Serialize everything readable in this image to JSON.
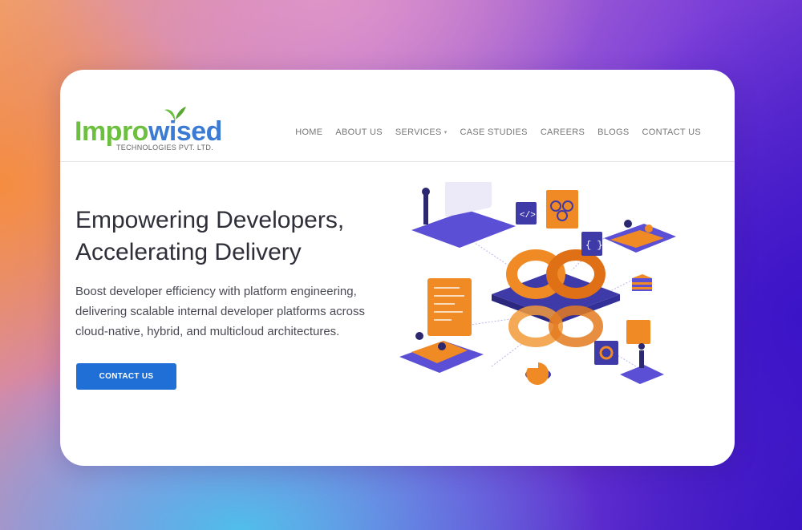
{
  "brand": {
    "name_part1": "Impro",
    "name_part2": "wised",
    "tagline": "TECHNOLOGIES PVT. LTD.",
    "colors": {
      "green": "#6cbf3f",
      "blue": "#3b7bd4"
    }
  },
  "nav": {
    "items": [
      {
        "label": "HOME"
      },
      {
        "label": "ABOUT US"
      },
      {
        "label": "SERVICES",
        "has_dropdown": true
      },
      {
        "label": "CASE STUDIES"
      },
      {
        "label": "CAREERS"
      },
      {
        "label": "BLOGS"
      },
      {
        "label": "CONTACT US"
      }
    ]
  },
  "hero": {
    "title_line1": "Empowering Developers,",
    "title_line2": "Accelerating Delivery",
    "desc_line1": "Boost developer efficiency with platform engineering,",
    "desc_line2": "delivering scalable internal developer platforms across",
    "desc_line3": "cloud-native, hybrid, and multicloud architectures.",
    "cta_label": "CONTACT US",
    "cta_color": "#1f6fd6"
  },
  "illustration": {
    "icon": "devops-infinity-isometric-illustration",
    "code_badge_1": "</>",
    "code_badge_2": "{ }",
    "colors": {
      "purple": "#5b4fd6",
      "orange": "#f08a24"
    }
  }
}
